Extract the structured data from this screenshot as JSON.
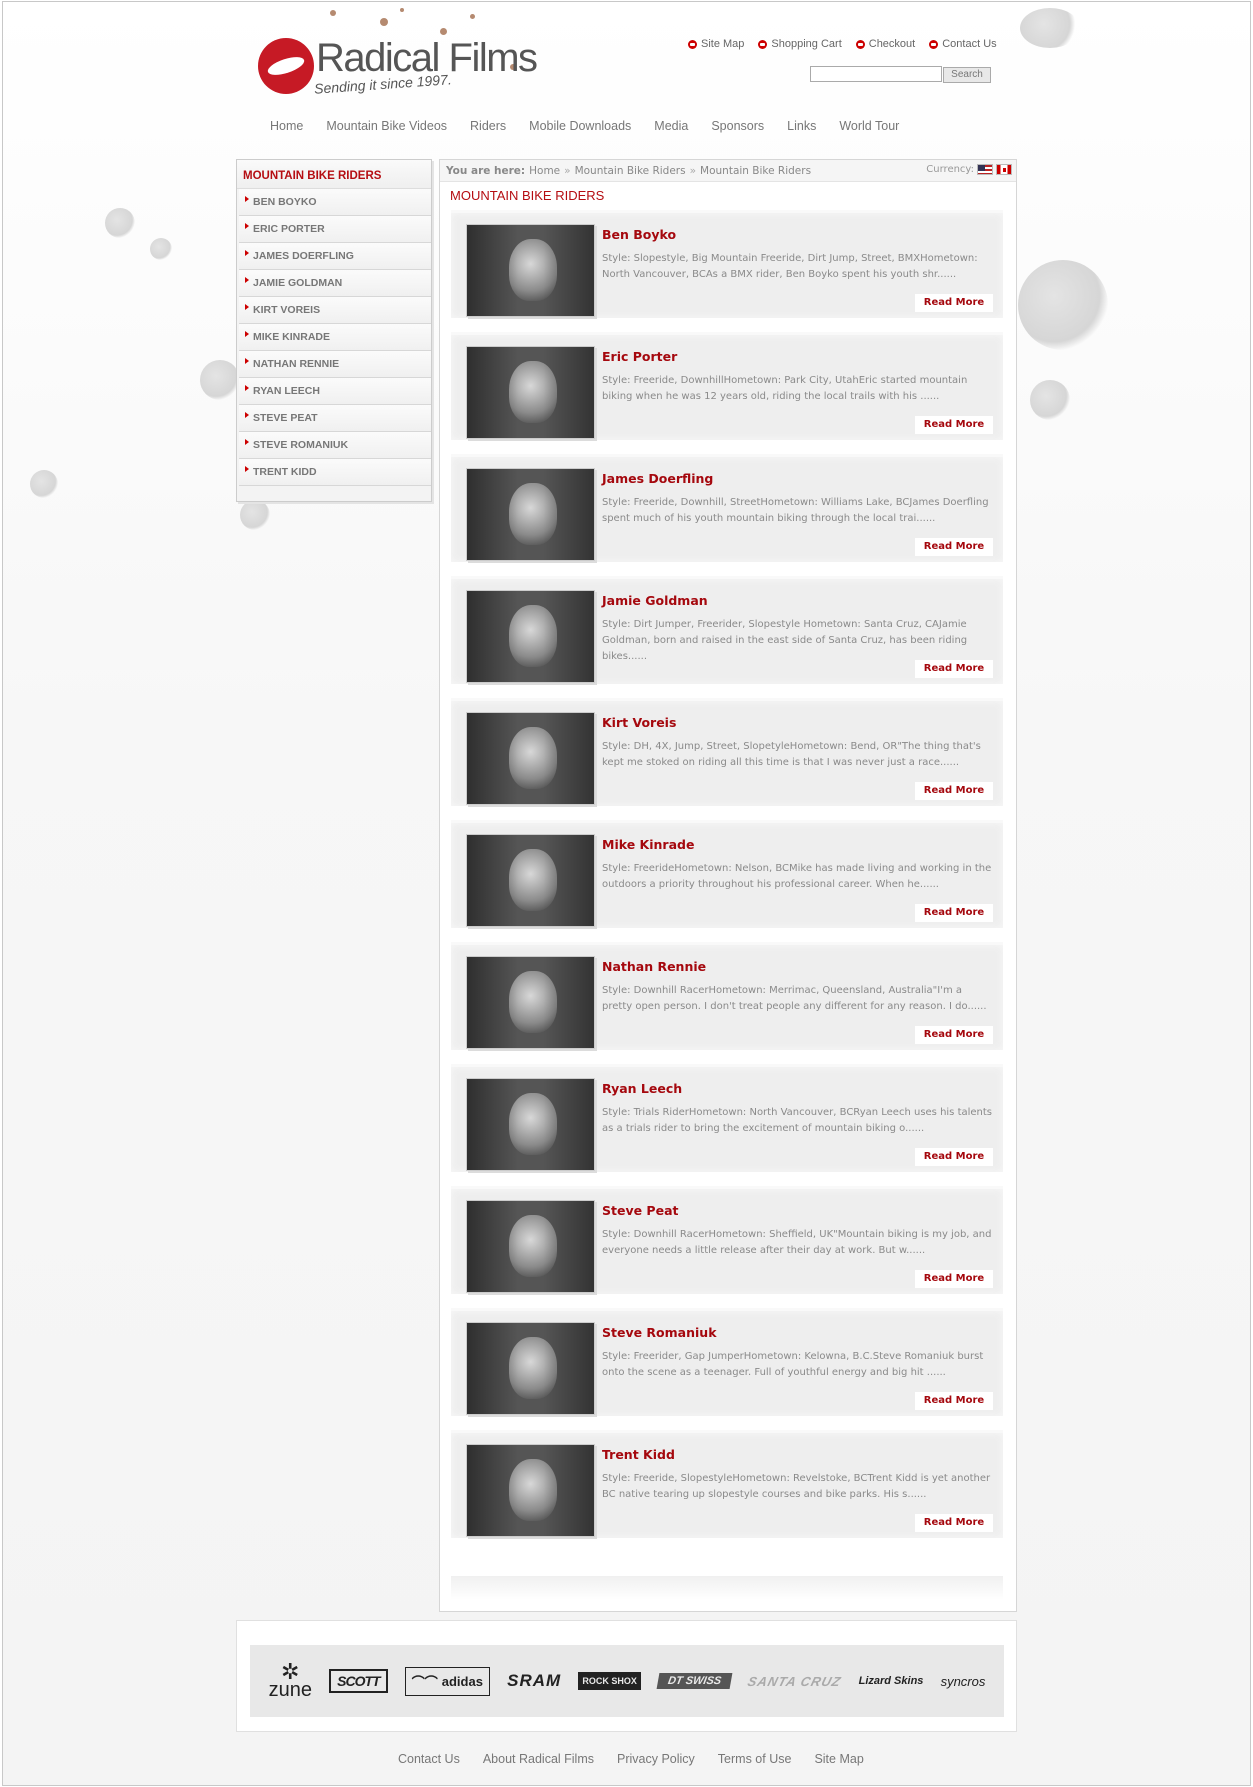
{
  "logo": {
    "title": "Radical Films",
    "tagline": "Sending it since 1997."
  },
  "top_links": [
    "Site Map",
    "Shopping Cart",
    "Checkout",
    "Contact Us"
  ],
  "search": {
    "placeholder": "",
    "button": "Search"
  },
  "main_nav": [
    "Home",
    "Mountain Bike Videos",
    "Riders",
    "Mobile Downloads",
    "Media",
    "Sponsors",
    "Links",
    "World Tour"
  ],
  "sidebar": {
    "title": "MOUNTAIN BIKE RIDERS",
    "items": [
      "BEN BOYKO",
      "ERIC PORTER",
      "JAMES DOERFLING",
      "JAMIE GOLDMAN",
      "KIRT VOREIS",
      "MIKE KINRADE",
      "NATHAN RENNIE",
      "RYAN LEECH",
      "STEVE PEAT",
      "STEVE ROMANIUK",
      "TRENT KIDD"
    ]
  },
  "breadcrumb": {
    "label": "You are here:",
    "items": [
      "Home",
      "Mountain Bike Riders",
      "Mountain Bike Riders"
    ],
    "separator": "»"
  },
  "currency": {
    "label": "Currency:"
  },
  "content_title": "MOUNTAIN BIKE RIDERS",
  "read_more": "Read More",
  "riders": [
    {
      "name": "Ben Boyko",
      "desc": "Style:  Slopestyle, Big Mountain Freeride, Dirt Jump, Street, BMXHometown:  North Vancouver, BCAs a BMX rider, Ben Boyko spent his youth shr......"
    },
    {
      "name": "Eric Porter",
      "desc": "Style:  Freeride, DownhillHometown:  Park City, UtahEric started mountain biking when he was 12 years old, riding the local trails with his ......"
    },
    {
      "name": "James Doerfling",
      "desc": "Style:  Freeride, Downhill, StreetHometown:  Williams Lake, BCJames Doerfling spent much of his youth mountain biking through the local trai......"
    },
    {
      "name": "Jamie Goldman",
      "desc": "Style: Dirt Jumper, Freerider, Slopestyle Hometown: Santa Cruz, CAJamie Goldman, born and raised in the east side of Santa Cruz, has been riding bikes......"
    },
    {
      "name": "Kirt Voreis",
      "desc": "Style:  DH, 4X, Jump, Street, SlopetyleHometown: Bend, OR\"The thing that's kept me stoked on riding all this time is that I was never just a race......"
    },
    {
      "name": "Mike Kinrade",
      "desc": "Style:  FreerideHometown: Nelson, BCMike has made living and working in the outdoors a priority throughout his professional career. When he......"
    },
    {
      "name": "Nathan Rennie",
      "desc": "Style:  Downhill RacerHometown: Merrimac, Queensland, Australia\"I'm a pretty open person. I don't treat people any different for any reason. I do......"
    },
    {
      "name": "Ryan Leech",
      "desc": "Style:  Trials RiderHometown:  North Vancouver, BCRyan Leech uses his talents as a trials rider to bring the excitement of mountain biking o......"
    },
    {
      "name": "Steve Peat",
      "desc": "Style:  Downhill RacerHometown:  Sheffield, UK\"Mountain biking is my job, and everyone needs a little release after their day at work. But w......"
    },
    {
      "name": "Steve Romaniuk",
      "desc": "Style:  Freerider, Gap JumperHometown:  Kelowna, B.C.Steve Romaniuk burst onto the scene as a teenager. Full of youthful energy and big hit ......"
    },
    {
      "name": "Trent Kidd",
      "desc": "Style:  Freeride, SlopestyleHometown:  Revelstoke, BCTrent Kidd is yet another BC native tearing up slopestyle courses and bike parks. His s......"
    }
  ],
  "sponsors": {
    "zune": "zune",
    "scott": "SCOTT",
    "adidas": "adidas",
    "sram": "SRAM",
    "rockshox": "ROCK SHOX",
    "dtswiss": "DT SWISS",
    "santacruz": "SANTA CRUZ",
    "lizardskins": "Lizard Skins",
    "syncros": "syncros"
  },
  "footer_links": [
    "Contact Us",
    "About Radical Films",
    "Privacy Policy",
    "Terms of Use",
    "Site Map"
  ]
}
